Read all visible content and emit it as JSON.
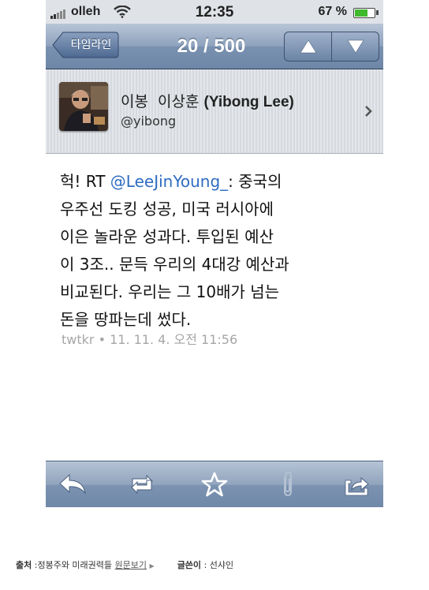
{
  "status_bar": {
    "carrier": "olleh",
    "time": "12:35",
    "battery": "67 %",
    "battery_level": 0.67
  },
  "nav": {
    "back_label": "타임라인",
    "title": "20 / 500",
    "up_icon": "arrow-up-icon",
    "down_icon": "arrow-down-icon"
  },
  "profile": {
    "name": "이봉  이상훈",
    "name_latin": "(Yibong Lee)",
    "handle": "@yibong"
  },
  "tweet": {
    "lines": [
      {
        "pre": "헉! RT ",
        "mention": "@LeeJinYoung_",
        "post": ": 중국의"
      },
      {
        "text": "우주선 도킹 성공, 미국 러시아에"
      },
      {
        "text": "이은 놀라운 성과다. 투입된 예산"
      },
      {
        "text": "이 3조.. 문득 우리의 4대강 예산과"
      },
      {
        "text": "비교된다. 우리는 그 10배가 넘는"
      },
      {
        "text": "돈을 땅파는데 썼다."
      }
    ],
    "meta": "twtkr • 11. 11. 4. 오전 11:56"
  },
  "toolbar": {
    "icons": [
      "reply-icon",
      "retweet-icon",
      "favorite-star-icon",
      "attachment-paperclip-icon",
      "share-icon"
    ]
  },
  "footer": {
    "source_label": "출처",
    "source_text": ":정봉주와 미래권력들",
    "source_link": "원문보기",
    "writer_label": "글쓴이",
    "writer_text": ": 선샤인"
  },
  "colors": {
    "nav_blue": "#7a91b0",
    "mention_blue": "#2f6cc2",
    "battery_green": "#3fba2d"
  }
}
